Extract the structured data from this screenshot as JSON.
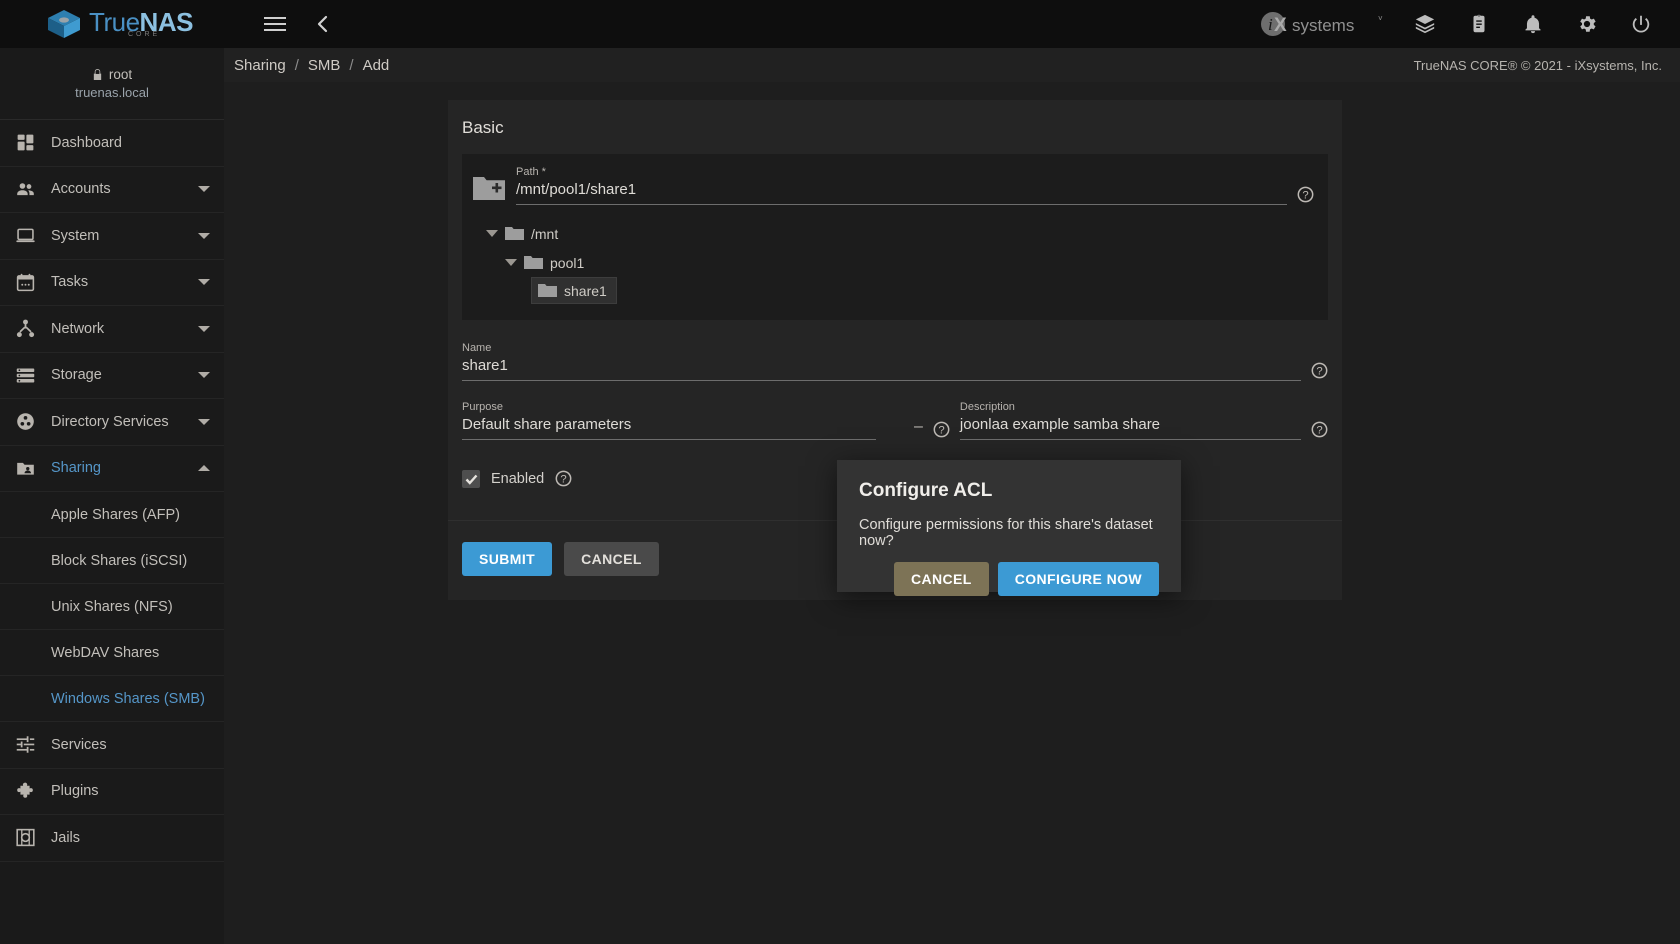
{
  "topbar": {
    "brand_true": "True",
    "brand_nas": "NAS",
    "brand_sub": "CORE",
    "menu_icon": "hamburger-icon",
    "back_icon": "chevron-left-icon",
    "vendor": "iXsystems",
    "icons": [
      "cube-icon",
      "clipboard-icon",
      "bell-icon",
      "gear-icon",
      "power-icon"
    ]
  },
  "sidebar": {
    "user": "root",
    "host": "truenas.local",
    "items": [
      {
        "label": "Dashboard",
        "icon": "dashboard-icon",
        "expandable": false,
        "active": false
      },
      {
        "label": "Accounts",
        "icon": "accounts-icon",
        "expandable": true,
        "active": false
      },
      {
        "label": "System",
        "icon": "system-icon",
        "expandable": true,
        "active": false
      },
      {
        "label": "Tasks",
        "icon": "tasks-icon",
        "expandable": true,
        "active": false
      },
      {
        "label": "Network",
        "icon": "network-icon",
        "expandable": true,
        "active": false
      },
      {
        "label": "Storage",
        "icon": "storage-icon",
        "expandable": true,
        "active": false
      },
      {
        "label": "Directory Services",
        "icon": "directory-services-icon",
        "expandable": true,
        "active": false
      },
      {
        "label": "Sharing",
        "icon": "sharing-icon",
        "expandable": true,
        "active": true,
        "expanded": true
      }
    ],
    "sharing_children": [
      {
        "label": "Apple Shares (AFP)",
        "active": false
      },
      {
        "label": "Block Shares (iSCSI)",
        "active": false
      },
      {
        "label": "Unix Shares (NFS)",
        "active": false
      },
      {
        "label": "WebDAV Shares",
        "active": false
      },
      {
        "label": "Windows Shares (SMB)",
        "active": true
      }
    ],
    "items_after": [
      {
        "label": "Services",
        "icon": "services-icon",
        "expandable": false,
        "active": false
      },
      {
        "label": "Plugins",
        "icon": "plugins-icon",
        "expandable": false,
        "active": false
      },
      {
        "label": "Jails",
        "icon": "jails-icon",
        "expandable": false,
        "active": false
      }
    ]
  },
  "breadcrumb": {
    "crumb1": "Sharing",
    "sep1": "/",
    "crumb2": "SMB",
    "sep2": "/",
    "crumb3": "Add",
    "copyright": "TrueNAS CORE® © 2021 - iXsystems, Inc."
  },
  "form": {
    "section_title": "Basic",
    "path": {
      "label": "Path *",
      "value": "/mnt/pool1/share1",
      "placeholder": "/mnt/pool1/share1"
    },
    "tree": [
      {
        "label": "/mnt",
        "level": 1,
        "expanded": true,
        "selected": false
      },
      {
        "label": "pool1",
        "level": 2,
        "expanded": true,
        "selected": false
      },
      {
        "label": "share1",
        "level": 3,
        "expanded": false,
        "selected": true
      }
    ],
    "name": {
      "label": "Name",
      "value": "share1",
      "placeholder": "Name"
    },
    "purpose": {
      "label": "Purpose",
      "value": "Default share parameters"
    },
    "description": {
      "label": "Description",
      "value": "joonlaa example samba share"
    },
    "enabled": {
      "label": "Enabled",
      "checked": true
    },
    "buttons": {
      "submit": "SUBMIT",
      "cancel": "CANCEL"
    }
  },
  "modal": {
    "title": "Configure ACL",
    "message": "Configure permissions for this share's dataset now?",
    "cancel_label": "CANCEL",
    "confirm_label": "CONFIGURE NOW"
  },
  "colors": {
    "accent": "#3c9ad4",
    "link": "#5596c8",
    "modal_cancel": "#7d7356",
    "topbar_bg": "#0e0e0e",
    "sidebar_bg": "#1a1a1a",
    "card_bg": "#252525"
  }
}
